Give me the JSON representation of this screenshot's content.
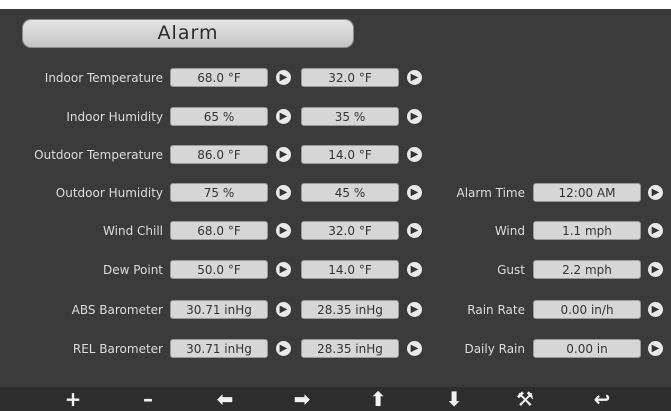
{
  "title": "Alarm",
  "rows_left": [
    {
      "label": "Indoor Temperature",
      "high": "68.0 °F",
      "low": "32.0 °F"
    },
    {
      "label": "Indoor Humidity",
      "high": "65 %",
      "low": "35 %"
    },
    {
      "label": "Outdoor Temperature",
      "high": "86.0 °F",
      "low": "14.0 °F"
    },
    {
      "label": "Outdoor Humidity",
      "high": "75 %",
      "low": "45 %"
    },
    {
      "label": "Wind Chill",
      "high": "68.0 °F",
      "low": "32.0 °F"
    },
    {
      "label": "Dew Point",
      "high": "50.0 °F",
      "low": "14.0 °F"
    },
    {
      "label": "ABS Barometer",
      "high": "30.71 inHg",
      "low": "28.35 inHg"
    },
    {
      "label": "REL Barometer",
      "high": "30.71 inHg",
      "low": "28.35 inHg"
    }
  ],
  "rows_right": [
    {
      "label": "Alarm Time",
      "value": "12:00 AM"
    },
    {
      "label": "Wind",
      "value": "1.1 mph"
    },
    {
      "label": "Gust",
      "value": "2.2 mph"
    },
    {
      "label": "Rain Rate",
      "value": "0.00 in/h"
    },
    {
      "label": "Daily Rain",
      "value": "0.00 in"
    }
  ],
  "toolbar": {
    "plus": "+",
    "minus": "–",
    "left": "⬅",
    "right": "➡",
    "up": "⬆",
    "down": "⬇",
    "tools": "⚒",
    "back": "↩"
  },
  "icons": {
    "pointer": "pointer-arrow-icon"
  }
}
